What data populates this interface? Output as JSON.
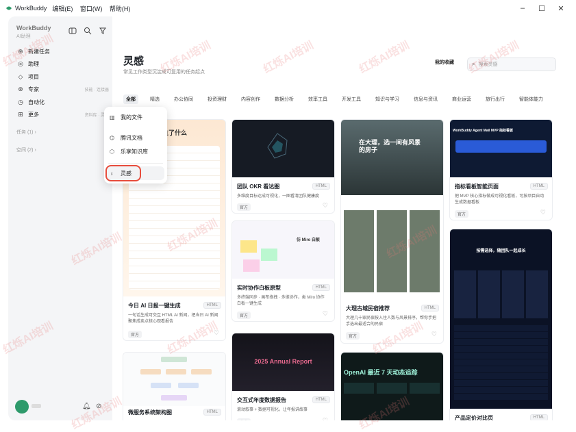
{
  "window": {
    "app_name": "WorkBuddy",
    "menu": [
      "编辑(E)",
      "窗口(W)",
      "帮助(H)"
    ],
    "controls": [
      "–",
      "☐",
      "✕"
    ]
  },
  "sidebar": {
    "brand": "WorkBuddy",
    "brand_sub": "AI助理",
    "items": [
      {
        "label": "新建任务",
        "icon": "plus-square-icon",
        "note": ""
      },
      {
        "label": "助理",
        "icon": "robot-icon",
        "note": ""
      },
      {
        "label": "项目",
        "icon": "folder-icon",
        "note": ""
      },
      {
        "label": "专家",
        "icon": "expert-icon",
        "note": "技能 · 连接器"
      },
      {
        "label": "自动化",
        "icon": "clock-icon",
        "note": ""
      },
      {
        "label": "更多",
        "icon": "grid-icon",
        "note": "资料库 · 灵感"
      }
    ],
    "sections": [
      "任务 (1) ›",
      "空间 (2) ›"
    ]
  },
  "dropdown": {
    "items": [
      {
        "label": "我的文件",
        "icon": "files-icon"
      },
      {
        "label": "腾讯文档",
        "icon": "docs-icon"
      },
      {
        "label": "乐享知识库",
        "icon": "knowledge-icon"
      },
      {
        "label": "灵感",
        "icon": "lightbulb-icon"
      }
    ]
  },
  "page": {
    "title": "灵感",
    "subtitle": "常见工作类型沉淀成可复用的任务起点",
    "my_favorites": "我的收藏",
    "search_placeholder": "搜索灵感"
  },
  "categories": [
    "全部",
    "精选",
    "办公协同",
    "投资理财",
    "内容创作",
    "数据分析",
    "效率工具",
    "开发工具",
    "知识与学习",
    "信息与资讯",
    "商业运营",
    "旅行出行",
    "智能体能力"
  ],
  "cards": [
    {
      "title": "今日 AI 日报一键生成",
      "badge": "HTML",
      "desc": "一句话生成可交互 HTML AI 新闻，把当日 AI 新闻聚焦成卖点核心观看报告",
      "tag": "官方",
      "thumb_text": "今天发生了什么"
    },
    {
      "title": "微服务系统架构图",
      "badge": "HTML",
      "desc": "",
      "tag": "",
      "thumb_text": ""
    },
    {
      "title": "团队 OKR 看达图",
      "badge": "HTML",
      "desc": "多维度目标达成可视化，一图看清团队健康度",
      "tag": "官方",
      "thumb_text": ""
    },
    {
      "title": "实时协作白板原型",
      "badge": "HTML",
      "desc": "多终端同步 · 画布拖拽 · 多维协作，类 Miro 协作白板一键生成",
      "tag": "官方",
      "thumb_text": "仿 Miro 白板"
    },
    {
      "title": "交互式年度数据报告",
      "badge": "HTML",
      "desc": "滚动叙事 + 数据可视化，让年报讲故事",
      "tag": "官方",
      "thumb_text": "2025 Annual Report"
    },
    {
      "title": "大理古城民宿推荐",
      "badge": "HTML",
      "desc": "大理几十家民宿按入住人数与风景排序，帮你手把手选出最适合的民宿",
      "tag": "官方",
      "thumb_text": "在大理，选一间有风景的房子"
    },
    {
      "title": "",
      "badge": "",
      "desc": "",
      "tag": "",
      "thumb_text": "OpenAI 最近 7 天动态追踪"
    },
    {
      "title": "指标看板智能页面",
      "badge": "HTML",
      "desc": "把 MVP 核心指标做成可视化看板，可按项目自动生成数据看板",
      "tag": "官方",
      "thumb_text": "WorkBuddy Agent Mail MVP 指标看板"
    },
    {
      "title": "产品定价对比页",
      "badge": "HTML",
      "desc": "",
      "tag": "",
      "thumb_text": "按需选择，随团队一起成长"
    }
  ],
  "bottom": {
    "bell_icon": "bell-icon",
    "settings_icon": "settings-icon"
  },
  "watermark": "红烁AI培训",
  "colors": {
    "accent_red": "#e74c3c",
    "green": "#2e9a6b"
  }
}
